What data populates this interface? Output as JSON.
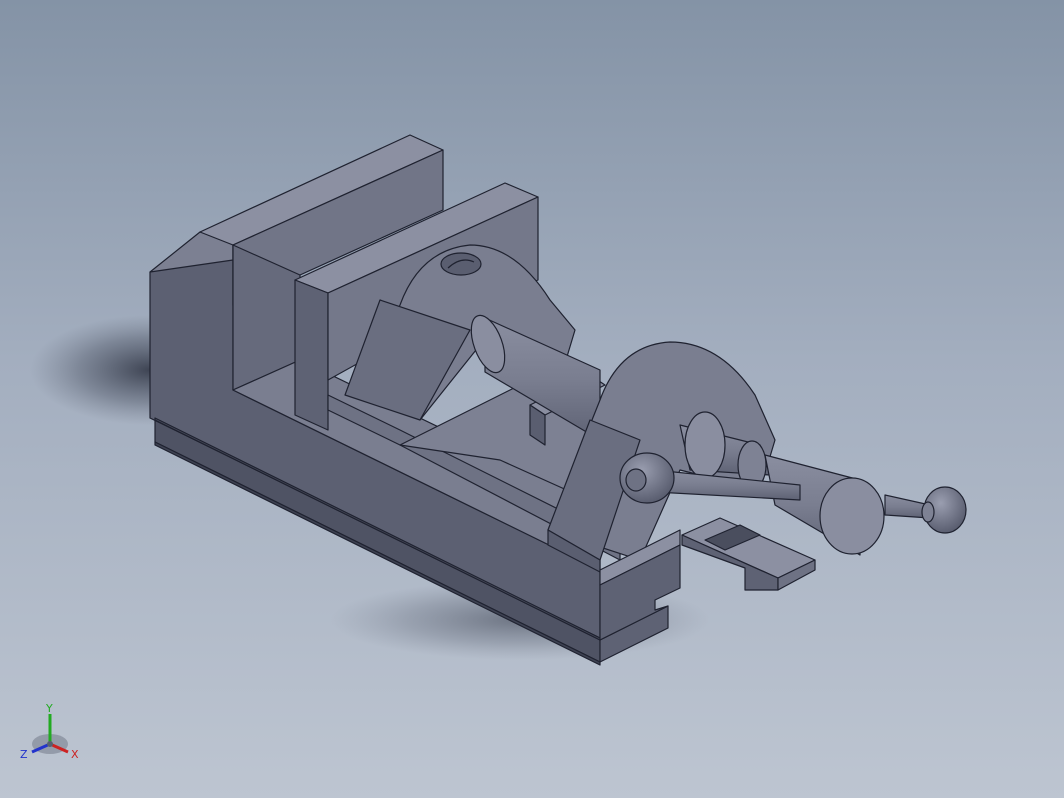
{
  "viewport": {
    "background_top": "#8493a6",
    "background_bottom": "#bdc5d1",
    "model_color": "#6e7283",
    "edge_color": "#1f2230"
  },
  "model": {
    "parts": [
      "vise-base",
      "fixed-jaw",
      "movable-jaw",
      "lead-screw",
      "handle-bar",
      "handle-ball-left",
      "handle-ball-right",
      "screw-boss"
    ]
  },
  "triad": {
    "x_label": "X",
    "y_label": "Y",
    "z_label": "Z",
    "x_color": "#cc2222",
    "y_color": "#22aa22",
    "z_color": "#2233cc"
  }
}
